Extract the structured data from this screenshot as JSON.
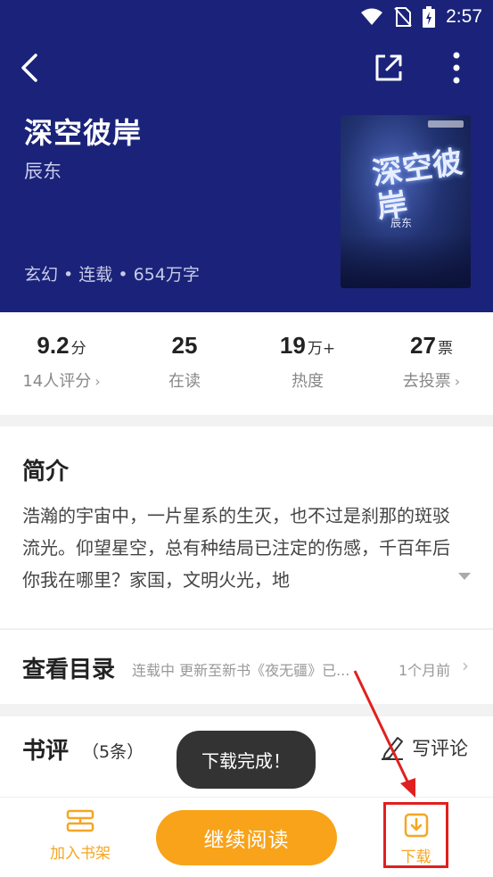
{
  "status_bar": {
    "time": "2:57",
    "icons": [
      "wifi-icon",
      "no-sim-icon",
      "battery-charging-icon"
    ]
  },
  "nav": {
    "icons": [
      "back-arrow-icon",
      "share-icon",
      "more-vertical-icon"
    ]
  },
  "book": {
    "title": "深空彼岸",
    "author": "辰东",
    "meta": "玄幻 • 连载 • 654万字",
    "cover": {
      "title_text": "深空彼岸",
      "author_text": "辰东"
    }
  },
  "stats": [
    {
      "value": "9.2",
      "unit": "分",
      "label": "14人评分",
      "has_chevron": true
    },
    {
      "value": "25",
      "unit": "",
      "label": "在读",
      "has_chevron": false
    },
    {
      "value": "19",
      "unit": "万+",
      "label": "热度",
      "has_chevron": false
    },
    {
      "value": "27",
      "unit": "票",
      "label": "去投票",
      "has_chevron": true
    }
  ],
  "intro": {
    "title": "简介",
    "text": "浩瀚的宇宙中，一片星系的生灭，也不过是刹那的斑驳流光。仰望星空，总有种结局已注定的伤感，千百年后你我在哪里？家国，文明火光，地"
  },
  "catalog": {
    "title": "查看目录",
    "desc": "连载中 更新至新书《夜无疆》已...",
    "time": "1个月前"
  },
  "reviews": {
    "title": "书评",
    "count": "（5条）",
    "write_label": "写评论"
  },
  "toast": {
    "text": "下载完成！"
  },
  "bottom_bar": {
    "shelf_label": "加入书架",
    "read_label": "继续阅读",
    "download_label": "下载"
  },
  "colors": {
    "header_bg": "#1a2379",
    "accent_orange": "#f8a31a",
    "annotation_red": "#e02020"
  }
}
